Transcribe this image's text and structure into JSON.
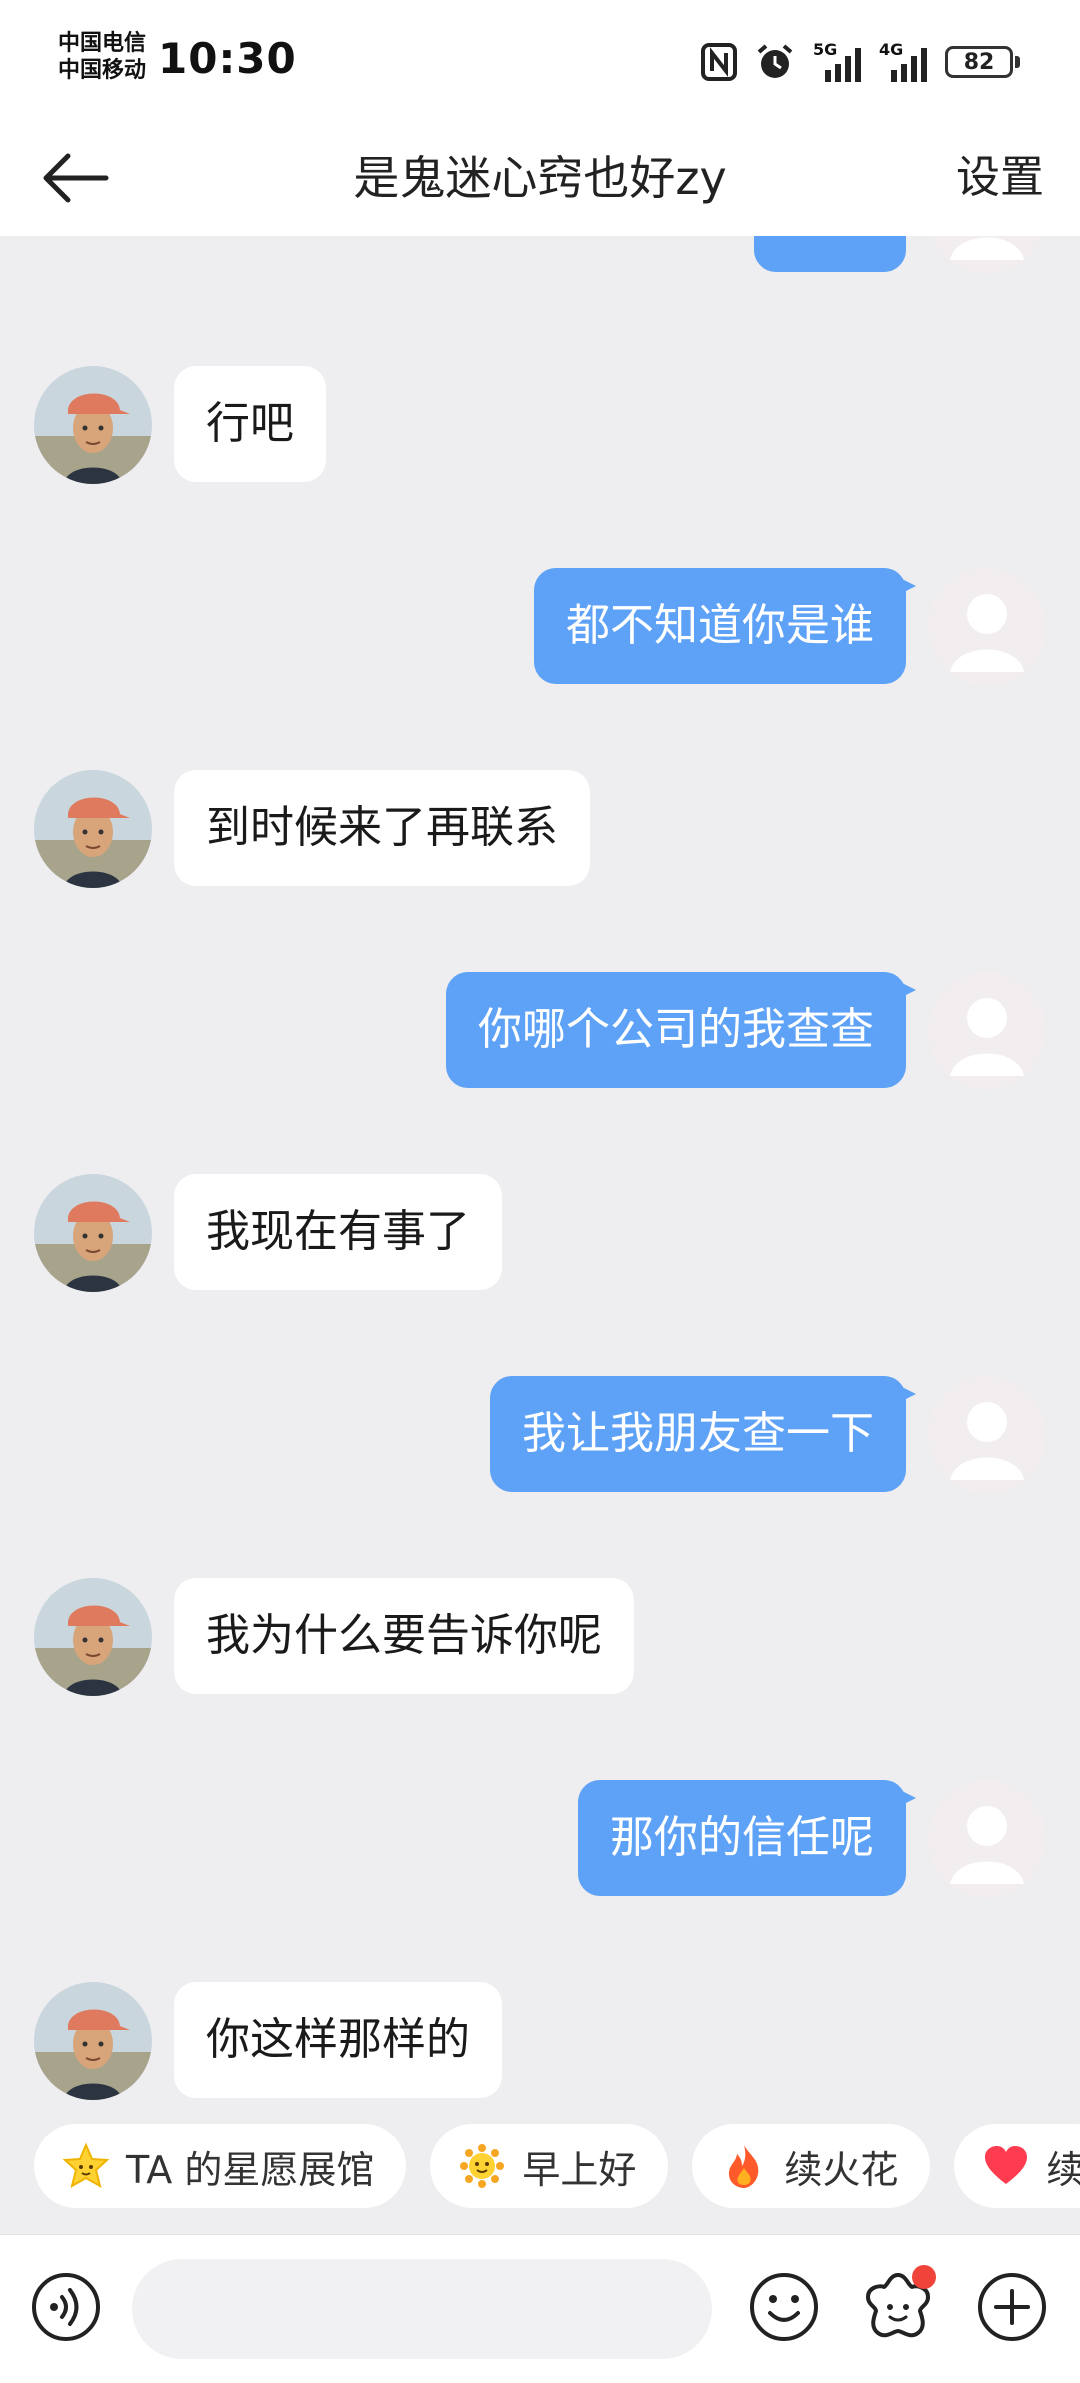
{
  "status_bar": {
    "carrier_1": "中国电信",
    "carrier_2": "中国移动",
    "time": "10:30",
    "net_1": "5G",
    "net_2": "4G",
    "battery": "82"
  },
  "header": {
    "title": "是鬼迷心窍也好zy",
    "settings_label": "设置"
  },
  "messages": [
    {
      "from": "other",
      "text": "行吧"
    },
    {
      "from": "me",
      "text": "都不知道你是谁"
    },
    {
      "from": "other",
      "text": "到时候来了再联系"
    },
    {
      "from": "me",
      "text": "你哪个公司的我查查"
    },
    {
      "from": "other",
      "text": "我现在有事了"
    },
    {
      "from": "me",
      "text": "我让我朋友查一下"
    },
    {
      "from": "other",
      "text": "我为什么要告诉你呢"
    },
    {
      "from": "me",
      "text": "那你的信任呢"
    },
    {
      "from": "other",
      "text": "你这样那样的"
    }
  ],
  "chips": [
    {
      "icon": "star-face-icon",
      "label": "TA 的星愿展馆"
    },
    {
      "icon": "sun-face-icon",
      "label": "早上好"
    },
    {
      "icon": "fire-icon",
      "label": "续火花"
    },
    {
      "icon": "heart-icon",
      "label": "续"
    }
  ],
  "input": {
    "placeholder": ""
  },
  "colors": {
    "my_bubble": "#5ea2f7",
    "other_bubble": "#ffffff",
    "chat_bg": "#eeedf0",
    "badge": "#f0443a"
  }
}
